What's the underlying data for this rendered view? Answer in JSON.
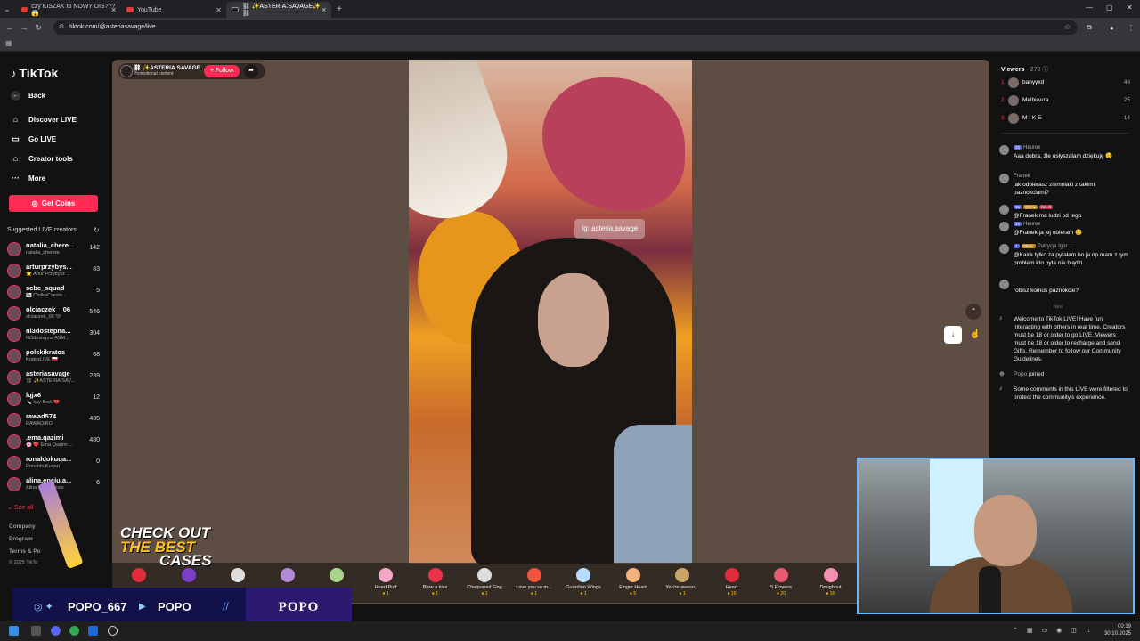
{
  "browser": {
    "tabs": [
      {
        "title": "czy KISZAK to NOWY DIS??? 😱"
      },
      {
        "title": "YouTube"
      },
      {
        "title": "⛓ ✨ASTERIA.SAVAGE✨⛓"
      }
    ],
    "url": "tiktok.com/@asteriasavage/live"
  },
  "sidebar": {
    "logo": "TikTok",
    "back": "Back",
    "nav": [
      {
        "label": "Discover LIVE"
      },
      {
        "label": "Go LIVE"
      },
      {
        "label": "Creator tools"
      },
      {
        "label": "More"
      }
    ],
    "get_coins": "Get Coins",
    "suggested_title": "Suggested LIVE creators",
    "creators": [
      {
        "name": "natalia_chere...",
        "sub": "natalia_chereta",
        "count": "142"
      },
      {
        "name": "arturprzybys...",
        "sub": "🌟 Artur Przybysz ...",
        "count": "83"
      },
      {
        "name": "scbc_squad",
        "sub": "👩‍👦 ClotkaCzesla...",
        "count": "5"
      },
      {
        "name": "olciaczek__06",
        "sub": "olciaczek_06 🖤",
        "count": "546"
      },
      {
        "name": "ni3dostepna...",
        "sub": "Ni3dostepna ASM...",
        "count": "304"
      },
      {
        "name": "polskikratos",
        "sub": "KratosLIVE 🇵🇱",
        "count": "68"
      },
      {
        "name": "asteriasavage",
        "sub": "⛓ ✨ASTERIA.SAV...",
        "count": "239"
      },
      {
        "name": "lqjx6",
        "sub": "🔪 kay flock 💔",
        "count": "12"
      },
      {
        "name": "rawad574",
        "sub": "RAWAD/RO",
        "count": "435"
      },
      {
        "name": ".ema.qazimi",
        "sub": "🌸 ❤️ Ema Qazimi ...",
        "count": "480"
      },
      {
        "name": "ronaldokuqa...",
        "sub": "Ronaldo Kuqari",
        "count": "0"
      },
      {
        "name": "alina.enciu.a...",
        "sub": "Alina Enciu Anciu",
        "count": "6"
      }
    ],
    "see_all": "See all",
    "footer": [
      "Company",
      "Program",
      "Terms & Po",
      "© 2025 TikTo"
    ]
  },
  "stream": {
    "host_name": "⛓ ✨ASTERIA.SAVAGE...",
    "host_sub": "Promotional content",
    "follow": "+ Follow",
    "overlay_text": "Ig: asteria.savage"
  },
  "gifts": [
    {
      "name": "Heart Puff",
      "price": "1",
      "color": "#f4a6c8"
    },
    {
      "name": "Blow a kiss",
      "price": "1",
      "color": "#e8334a"
    },
    {
      "name": "Chequered Flag",
      "price": "1",
      "color": "#dddddd"
    },
    {
      "name": "Love you so m...",
      "price": "1",
      "color": "#f1563c"
    },
    {
      "name": "Guardian Wings",
      "price": "1",
      "color": "#b8dcff"
    },
    {
      "name": "Finger Heart",
      "price": "5",
      "color": "#f2b27a"
    },
    {
      "name": "You're aweso...",
      "price": "1",
      "color": "#c9a46a"
    },
    {
      "name": "Heart",
      "price": "10",
      "color": "#e02c3c"
    },
    {
      "name": "5 Flowers",
      "price": "20",
      "color": "#e85a70"
    },
    {
      "name": "Doughnut",
      "price": "30",
      "color": "#f48fb1"
    }
  ],
  "viewers": {
    "title": "Viewers",
    "count": "· 270",
    "top": [
      {
        "rank": "1",
        "name": "banyyxd",
        "score": "46"
      },
      {
        "rank": "2",
        "name": "MelbiAura",
        "score": "25"
      },
      {
        "rank": "3",
        "name": "M I K E",
        "score": "14"
      }
    ]
  },
  "comments": [
    {
      "user": "Heurex",
      "badges": [
        "25"
      ],
      "text": "Aaa dobra, źle usłyszałam dziękuję 😊"
    },
    {
      "user": "Franek",
      "badges": [],
      "text": "jak odbierasz ziemniaki z takimi paznokciami?"
    },
    {
      "user": "",
      "badges": [
        "15",
        "ORAL",
        "No. 3"
      ],
      "text": "@Franek ma ludzi od tego"
    },
    {
      "user": "Heurex",
      "badges": [
        "25"
      ],
      "text": "@Franek ja jej obieram 😊"
    },
    {
      "user": "Patrycja Igor ...",
      "badges": [
        "7",
        "ORAL"
      ],
      "text": "@Kaira tylko za pytałam bo ja np mam z tym problem kto pyta nie błądzi"
    },
    {
      "user": "",
      "badges": [],
      "text": "robisz komuś paznokcie?"
    }
  ],
  "new_label": "New",
  "system_messages": {
    "welcome": "Welcome to TikTok LIVE! Have fun interacting with others in real time. Creators must be 18 or older to go LIVE. Viewers must be 18 or older to recharge and send Gifts. Remember to follow our Community Guidelines.",
    "joined_user": "Popo",
    "joined_text": "joined",
    "filtered": "Some comments in this LIVE were filtered to protect the community's experience."
  },
  "promo": {
    "line1": "CHECK OUT",
    "line2": "THE BEST",
    "line3": "CASES"
  },
  "social": {
    "handle1": "POPO_667",
    "handle2": "POPO",
    "brand": "POPO"
  },
  "taskbar": {
    "time": "00:19",
    "date": "30.10.2025"
  }
}
